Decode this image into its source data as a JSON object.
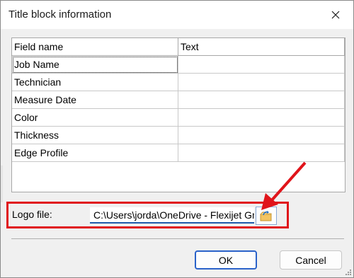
{
  "dialog": {
    "title": "Title block information"
  },
  "grid": {
    "columns": [
      "Field name",
      "Text"
    ],
    "rows": [
      {
        "field": "Job Name",
        "text": ""
      },
      {
        "field": "Technician",
        "text": ""
      },
      {
        "field": "Measure Date",
        "text": ""
      },
      {
        "field": "Color",
        "text": ""
      },
      {
        "field": "Thickness",
        "text": ""
      },
      {
        "field": "Edge Profile",
        "text": ""
      }
    ]
  },
  "logo": {
    "label": "Logo file:",
    "value": "C:\\Users\\jorda\\OneDrive - Flexijet GmbH"
  },
  "buttons": {
    "ok": "OK",
    "cancel": "Cancel"
  },
  "colors": {
    "highlight": "#e0141a",
    "focus": "#2a62c9"
  },
  "icons": {
    "close": "close-icon",
    "browse": "folder-icon",
    "annotation": "arrow-icon",
    "grip": "resize-grip-icon"
  }
}
